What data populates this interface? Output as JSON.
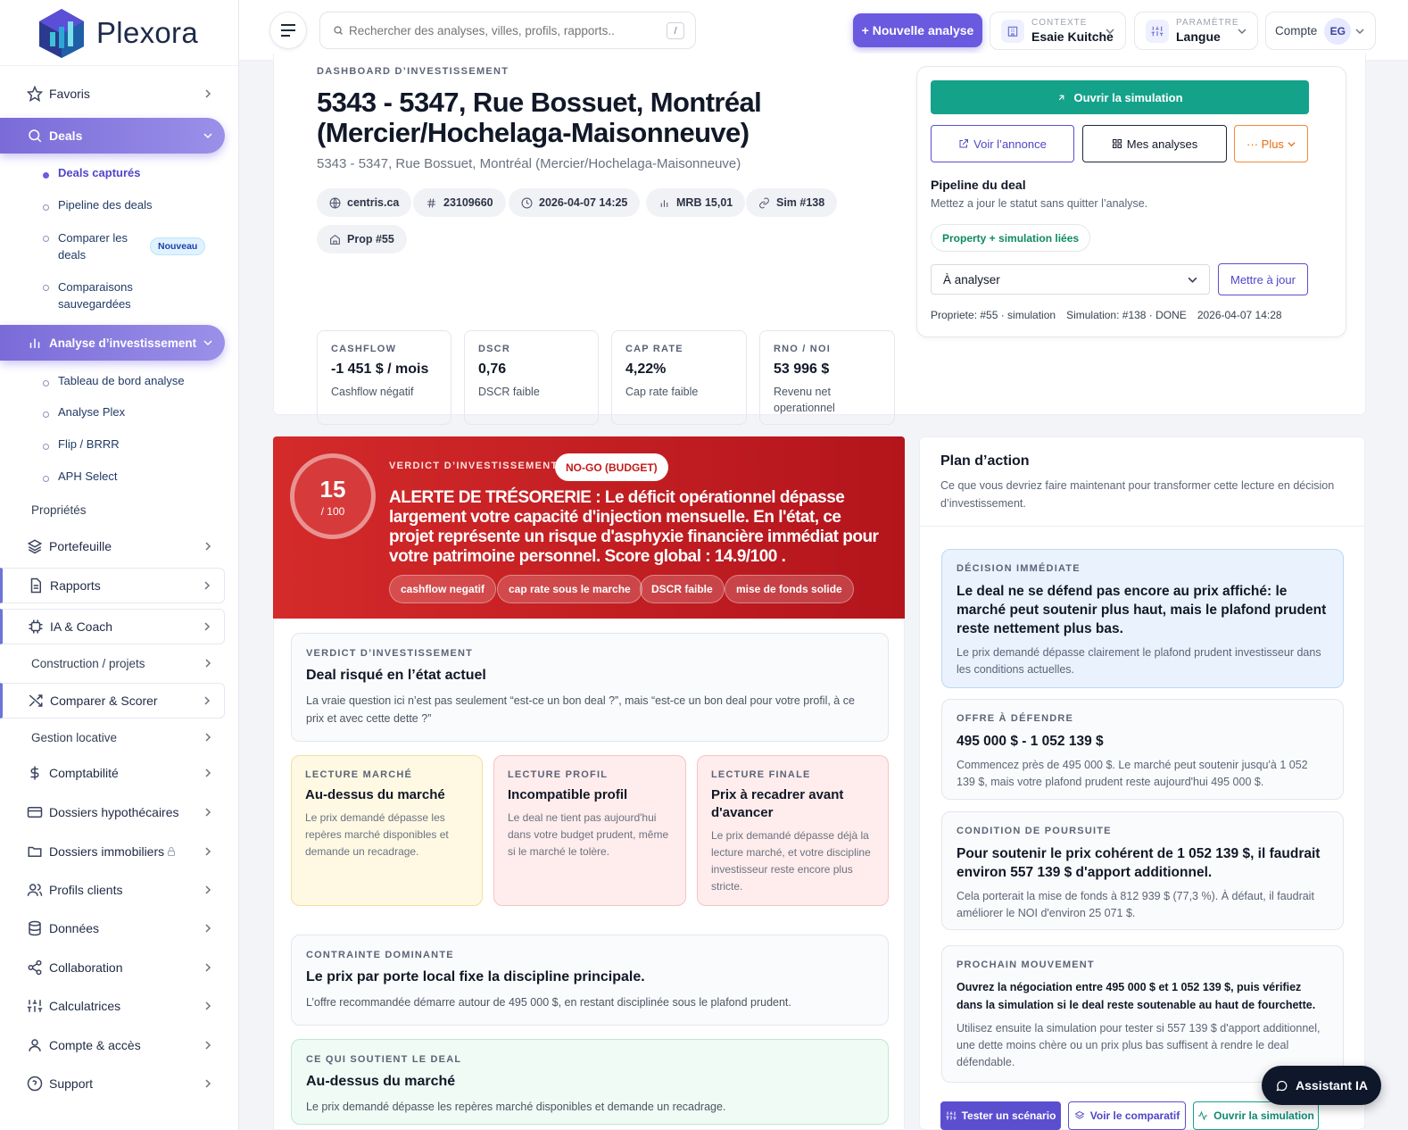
{
  "brand": {
    "name": "Plexora"
  },
  "sidebar": {
    "favoris": "Favoris",
    "deals": "Deals",
    "deals_sub": [
      "Deals capturés",
      "Pipeline des deals",
      "Comparer les deals",
      "Comparaisons sauvegardées"
    ],
    "new_badge": "Nouveau",
    "analyse": "Analyse d’investissement",
    "analyse_sub": [
      "Tableau de bord analyse",
      "Analyse Plex",
      "Flip / BRRR",
      "APH Select"
    ],
    "proprietes": "Propriétés",
    "portefeuille": "Portefeuille",
    "rapports": "Rapports",
    "ia_coach": "IA & Coach",
    "construction": "Construction / projets",
    "comparer": "Comparer & Scorer",
    "gestion": "Gestion locative",
    "comptabilite": "Comptabilité",
    "hypothecaires": "Dossiers hypothécaires",
    "immobiliers": "Dossiers immobiliers",
    "profils": "Profils clients",
    "donnees": "Données",
    "collaboration": "Collaboration",
    "calculatrices": "Calculatrices",
    "compte": "Compte & accès",
    "support": "Support"
  },
  "topbar": {
    "search_placeholder": "Rechercher des analyses, villes, profils, rapports..",
    "search_kbd": "/",
    "new_analysis": "+ Nouvelle analyse",
    "context_label": "CONTEXTE",
    "context_value": "Esaie Kuitche",
    "param_label": "PARAMÈTRE",
    "param_value": "Langue",
    "account_label": "Compte",
    "avatar": "EG"
  },
  "header": {
    "eyebrow": "DASHBOARD D’INVESTISSEMENT",
    "title_line1": "5343 - 5347, Rue Bossuet, Montréal",
    "title_line2": "(Mercier/Hochelaga-Maisonneuve)",
    "subtitle": "5343 - 5347, Rue Bossuet, Montréal (Mercier/Hochelaga-Maisonneuve)",
    "pills": [
      "centris.ca",
      "23109660",
      "2026-04-07 14:25",
      "MRB 15,01",
      "Sim #138",
      "Prop #55"
    ],
    "kpis": [
      {
        "label": "CASHFLOW",
        "value": "-1 451 $ / mois",
        "sub": "Cashflow négatif"
      },
      {
        "label": "DSCR",
        "value": "0,76",
        "sub": "DSCR faible"
      },
      {
        "label": "CAP RATE",
        "value": "4,22%",
        "sub": "Cap rate faible"
      },
      {
        "label": "RNO / NOI",
        "value": "53 996 $",
        "sub": "Revenu net operationnel"
      }
    ]
  },
  "pipeline": {
    "open_sim": "Ouvrir la simulation",
    "view_listing": "Voir l’annonce",
    "my_analyses": "Mes analyses",
    "more": "··· Plus",
    "title": "Pipeline du deal",
    "desc": "Mettez a jour le statut sans quitter l’analyse.",
    "linked": "Property + simulation liées",
    "status": "À analyser",
    "update": "Mettre à jour",
    "meta": [
      "Propriete: #55 · simulation",
      "Simulation: #138 · DONE",
      "2026-04-07 14:28"
    ]
  },
  "verdict": {
    "score": "15",
    "score_of": "/ 100",
    "label": "VERDICT D’INVESTISSEMENT",
    "badge": "NO-GO (BUDGET)",
    "alert": "ALERTE DE TRÉSORERIE : Le déficit opérationnel dépasse largement votre capacité d'injection mensuelle. En l'état, ce projet représente un risque d'asphyxie financière immédiat pour votre patrimoine personnel. Score global : 14.9/100 .",
    "tags": [
      "cashflow negatif",
      "cap rate sous le marche",
      "DSCR faible",
      "mise de fonds solide"
    ],
    "box1": {
      "label": "VERDICT D’INVESTISSEMENT",
      "title": "Deal risqué en l’état actuel",
      "desc": "La vraie question ici n’est pas seulement “est-ce un bon deal ?”, mais “est-ce un bon deal pour votre profil, à ce prix et avec cette dette ?”"
    },
    "cards": [
      {
        "label": "LECTURE MARCHÉ",
        "title": "Au-dessus du marché",
        "desc": "Le prix demandé dépasse les repères marché disponibles et demande un recadrage."
      },
      {
        "label": "LECTURE PROFIL",
        "title": "Incompatible profil",
        "desc": "Le deal ne tient pas aujourd'hui dans votre budget prudent, même si le marché le tolère."
      },
      {
        "label": "LECTURE FINALE",
        "title": "Prix à recadrer avant d'avancer",
        "desc": "Le prix demandé dépasse déjà la lecture marché, et votre discipline investisseur reste encore plus stricte."
      }
    ],
    "box2": {
      "label": "CONTRAINTE DOMINANTE",
      "title": "Le prix par porte local fixe la discipline principale.",
      "desc": "L’offre recommandée démarre autour de 495 000 $, en restant disciplinée sous le plafond prudent."
    },
    "box3": {
      "label": "CE QUI SOUTIENT LE DEAL",
      "title": "Au-dessus du marché",
      "desc": "Le prix demandé dépasse les repères marché disponibles et demande un recadrage."
    }
  },
  "plan": {
    "title": "Plan d’action",
    "desc": "Ce que vous devriez faire maintenant pour transformer cette lecture en décision d’investissement.",
    "items": [
      {
        "label": "DÉCISION IMMÉDIATE",
        "title": "Le deal ne se défend pas encore au prix affiché: le marché peut soutenir plus haut, mais le plafond prudent reste nettement plus bas.",
        "desc": "Le prix demandé dépasse clairement le plafond prudent investisseur dans les conditions actuelles."
      },
      {
        "label": "OFFRE À DÉFENDRE",
        "title": "495 000 $ - 1 052 139 $",
        "desc": "Commencez près de 495 000 $. Le marché peut soutenir jusqu'à 1 052 139 $, mais votre plafond prudent reste aujourd'hui 495 000 $."
      },
      {
        "label": "CONDITION DE POURSUITE",
        "title": "Pour soutenir le prix cohérent de 1 052 139 $, il faudrait environ 557 139 $ d'apport additionnel.",
        "desc": "Cela porterait la mise de fonds à 812 939 $ (77,3 %). À défaut, il faudrait améliorer le NOI d'environ 25 071 $."
      },
      {
        "label": "PROCHAIN MOUVEMENT",
        "title": "Ouvrez la négociation entre 495 000 $ et 1 052 139 $, puis vérifiez dans la simulation si le deal reste soutenable au haut de fourchette.",
        "desc": "Utilisez ensuite la simulation pour tester si 557 139 $ d'apport additionnel, une dette moins chère ou un prix plus bas suffisent à rendre le deal défendable."
      }
    ],
    "btn_test": "Tester un scénario",
    "btn_compare": "Voir le comparatif",
    "btn_sim": "Ouvrir la simulation"
  },
  "assistant": "Assistant IA"
}
